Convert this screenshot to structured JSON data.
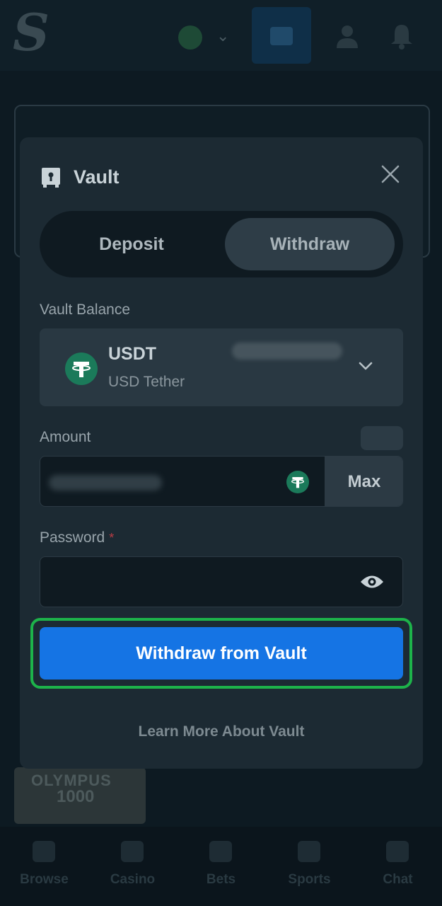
{
  "header": {
    "logo_letter": "S"
  },
  "background_game": {
    "title_line1": "OLYMPUS",
    "title_line2": "1000"
  },
  "bottom_nav": {
    "items": [
      {
        "label": "Browse",
        "icon": "browse-icon"
      },
      {
        "label": "Casino",
        "icon": "casino-icon"
      },
      {
        "label": "Bets",
        "icon": "bets-icon"
      },
      {
        "label": "Sports",
        "icon": "sports-icon"
      },
      {
        "label": "Chat",
        "icon": "chat-icon"
      }
    ]
  },
  "modal": {
    "title": "Vault",
    "icon": "vault-icon",
    "tabs": {
      "deposit": "Deposit",
      "withdraw": "Withdraw",
      "active": "Withdraw"
    },
    "vault_balance_label": "Vault Balance",
    "asset": {
      "code": "USDT",
      "name": "USD Tether",
      "icon": "tether-icon"
    },
    "amount_label": "Amount",
    "max_label": "Max",
    "password_label": "Password",
    "required_mark": "*",
    "submit_label": "Withdraw from Vault",
    "learn_more": "Learn More About Vault"
  },
  "colors": {
    "primary_button": "#1574e4",
    "highlight_border": "#1db34a",
    "modal_bg": "#1c2a33",
    "tether_green": "#1b7a5a"
  }
}
